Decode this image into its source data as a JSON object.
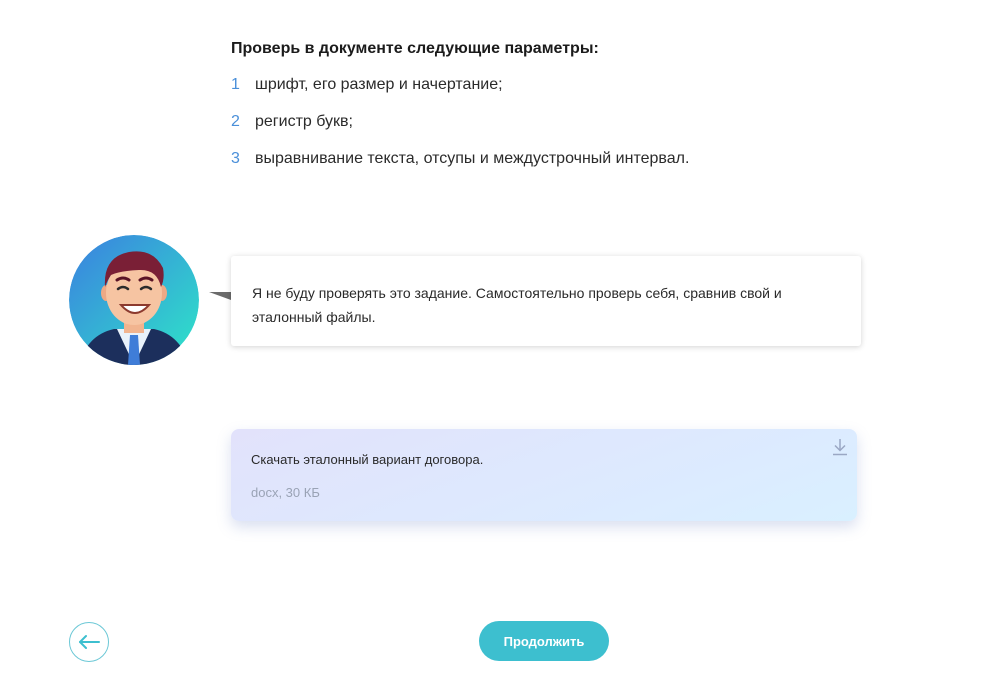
{
  "instructions": {
    "heading": "Проверь в документе следующие параметры:",
    "items": [
      {
        "num": "1",
        "text": "шрифт, его размер и начертание;"
      },
      {
        "num": "2",
        "text": "регистр букв;"
      },
      {
        "num": "3",
        "text": "выравнивание текста, отсупы и междустрочный интервал."
      }
    ]
  },
  "tutor": {
    "avatar_icon": "tutor-avatar-icon",
    "message": "Я не буду проверять это задание. Самостоятельно проверь себя, сравнив свой и эталонный файлы."
  },
  "download": {
    "title": "Скачать эталонный вариант договора.",
    "meta": "docx, 30 КБ",
    "icon": "download-icon"
  },
  "navigation": {
    "back_icon": "arrow-left-icon",
    "continue_label": "Продолжить"
  },
  "colors": {
    "accent": "#3dbfcf",
    "step_number": "#4a8fd9",
    "meta_text": "#9aa3b5"
  }
}
